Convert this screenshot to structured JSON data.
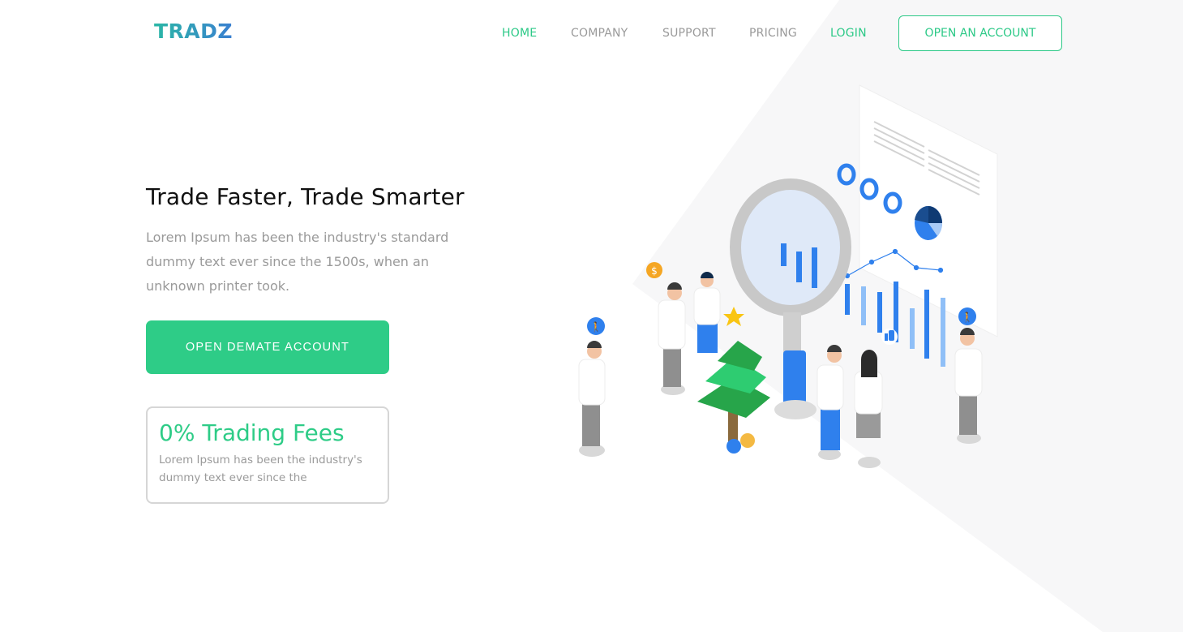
{
  "brand": {
    "name": "TRADZ"
  },
  "nav": {
    "items": [
      {
        "label": "HOME",
        "active": true
      },
      {
        "label": "COMPANY",
        "active": false
      },
      {
        "label": "SUPPORT",
        "active": false
      },
      {
        "label": "PRICING",
        "active": false
      },
      {
        "label": "LOGIN",
        "active": false
      }
    ],
    "cta_label": "OPEN AN ACCOUNT"
  },
  "hero": {
    "title": "Trade Faster, Trade Smarter",
    "description": "Lorem Ipsum has been the industry's standard dummy text ever since the 1500s, when an unknown printer took.",
    "button_label": "OPEN DEMATE ACCOUNT"
  },
  "feature_card": {
    "title": "0% Trading Fees",
    "text": "Lorem Ipsum has been the industry's dummy text ever since the"
  },
  "illustration": {
    "icons": [
      "magnifier-icon",
      "bar-chart-icon",
      "pie-chart-icon",
      "dollar-coin-icon",
      "walking-person-icon",
      "thumbs-up-icon",
      "star-icon",
      "tree-icon"
    ]
  },
  "colors": {
    "accent_green": "#2ecc87",
    "accent_blue": "#2f80ed",
    "text_gray": "#9a9a9a",
    "heading": "#111111"
  }
}
